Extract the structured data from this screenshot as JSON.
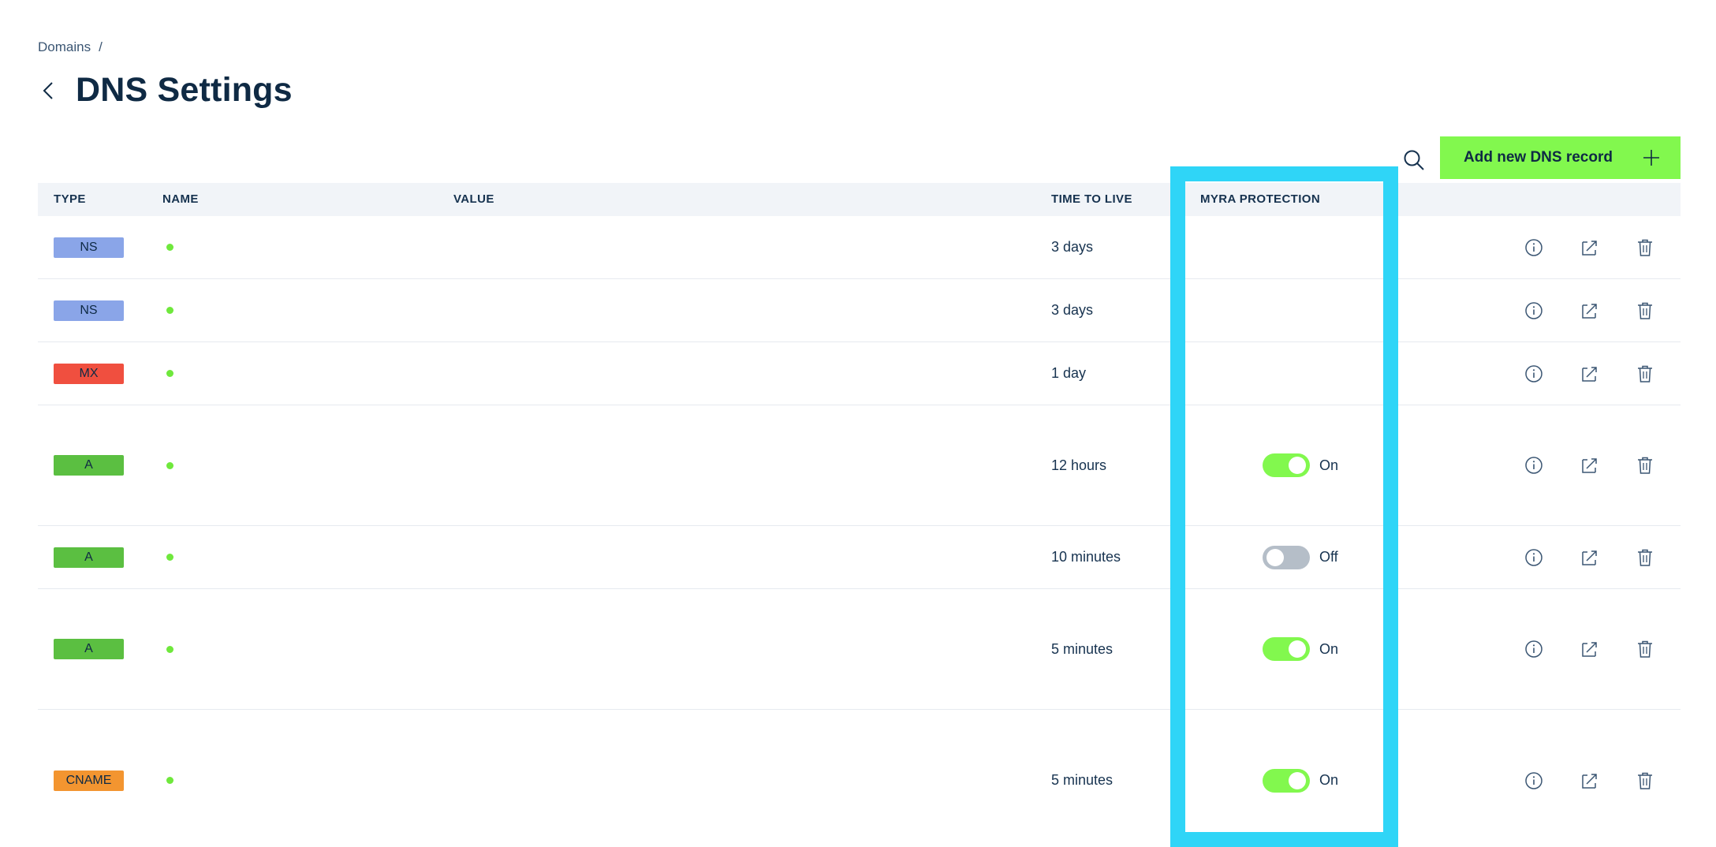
{
  "breadcrumb": {
    "root": "Domains",
    "separator": "/"
  },
  "page": {
    "title": "DNS Settings"
  },
  "toolbar": {
    "add_label": "Add new DNS record",
    "add_icon": "plus-icon",
    "search_icon": "search-icon"
  },
  "table": {
    "headers": {
      "type": "TYPE",
      "name": "NAME",
      "value": "VALUE",
      "ttl": "TIME TO LIVE",
      "protection": "MYRA PROTECTION"
    },
    "rows": [
      {
        "type": "NS",
        "type_color": "#8aa5e8",
        "ttl": "3 days",
        "protection": null
      },
      {
        "type": "NS",
        "type_color": "#8aa5e8",
        "ttl": "3 days",
        "protection": null
      },
      {
        "type": "MX",
        "type_color": "#f04f3f",
        "ttl": "1 day",
        "protection": null
      },
      {
        "type": "A",
        "type_color": "#5bbf41",
        "ttl": "12 hours",
        "protection": {
          "state": "on",
          "label": "On"
        }
      },
      {
        "type": "A",
        "type_color": "#5bbf41",
        "ttl": "10 minutes",
        "protection": {
          "state": "off",
          "label": "Off"
        }
      },
      {
        "type": "A",
        "type_color": "#5bbf41",
        "ttl": "5 minutes",
        "protection": {
          "state": "on",
          "label": "On"
        }
      },
      {
        "type": "CNAME",
        "type_color": "#f39530",
        "ttl": "5 minutes",
        "protection": {
          "state": "on",
          "label": "On"
        }
      }
    ]
  },
  "colors": {
    "accent": "#82f84e",
    "highlight": "#2fd5f7",
    "text": "#0f2a44"
  }
}
